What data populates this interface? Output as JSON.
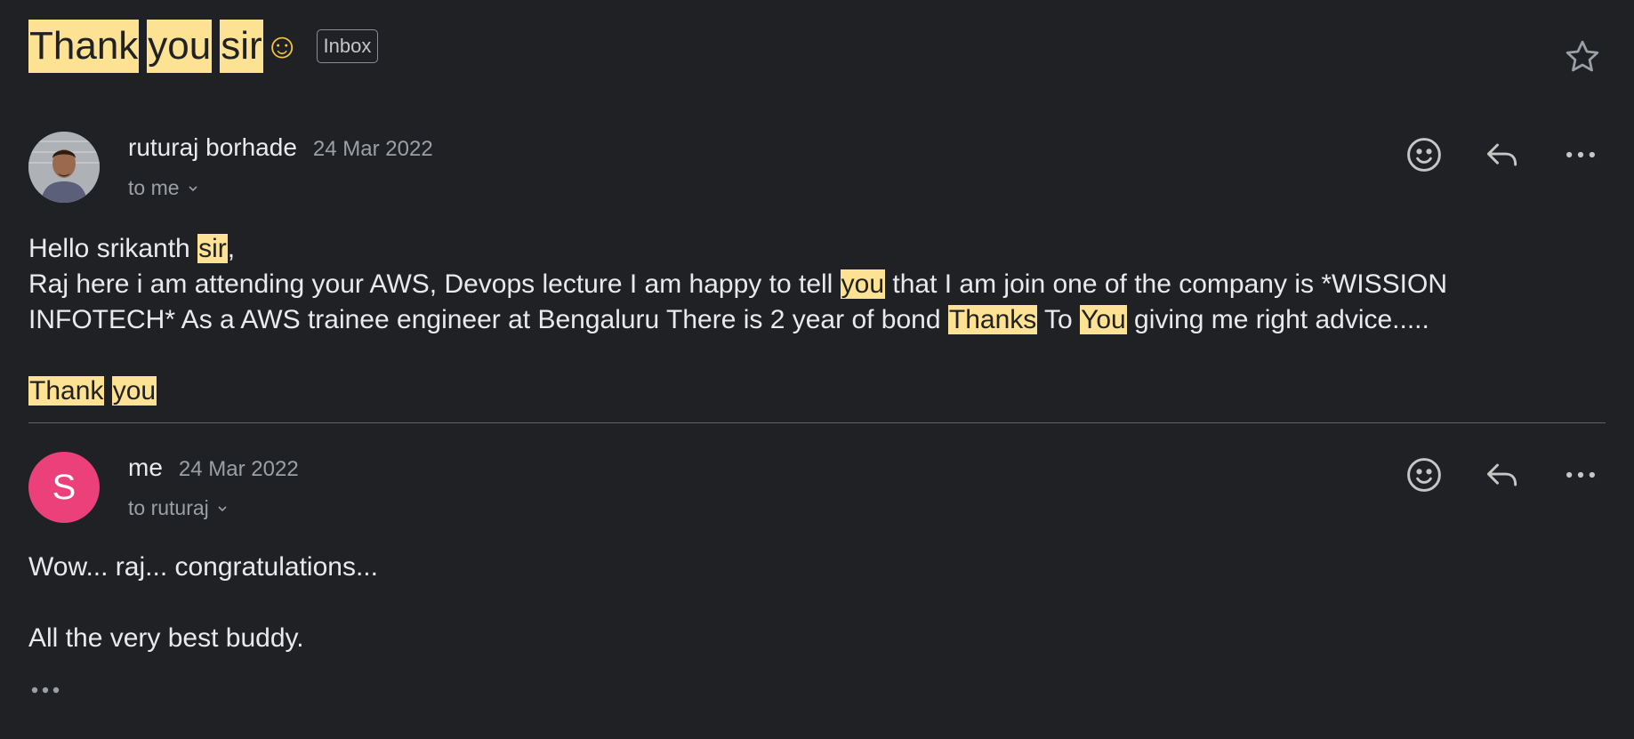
{
  "subject": {
    "words": [
      "Thank",
      "you",
      "sir"
    ],
    "emoji": "☺",
    "label": "Inbox"
  },
  "messages": [
    {
      "sender": "ruturaj borhade",
      "date": "24 Mar 2022",
      "to": "to me",
      "body": {
        "greeting_pre": "Hello srikanth ",
        "greeting_hl": "sir",
        "greeting_post": ",",
        "line1_pre": "Raj here i am attending your AWS, Devops lecture I am happy to tell ",
        "line1_hl": "you",
        "line1_post": " that I am join one of the company is *WISSION",
        "line2_pre": "INFOTECH* As a AWS trainee engineer at Bengaluru There is 2 year of bond ",
        "line2_hl1": "Thanks",
        "line2_mid": " To ",
        "line2_hl2": "You",
        "line2_post": " giving me right advice.....",
        "sign_hl1": "Thank",
        "sign_hl2": "you"
      }
    },
    {
      "sender": "me",
      "avatar_letter": "S",
      "date": "24 Mar 2022",
      "to": "to ruturaj",
      "body": {
        "line1": "Wow... raj... congratulations...",
        "line2": "All the very best buddy."
      }
    }
  ],
  "colors": {
    "background": "#202124",
    "highlight": "#fde293",
    "avatar_me": "#ec407a"
  },
  "icons": [
    "star-icon",
    "emoji-react-icon",
    "reply-icon",
    "more-options-icon",
    "chevron-down-icon",
    "show-trimmed-content-icon"
  ]
}
